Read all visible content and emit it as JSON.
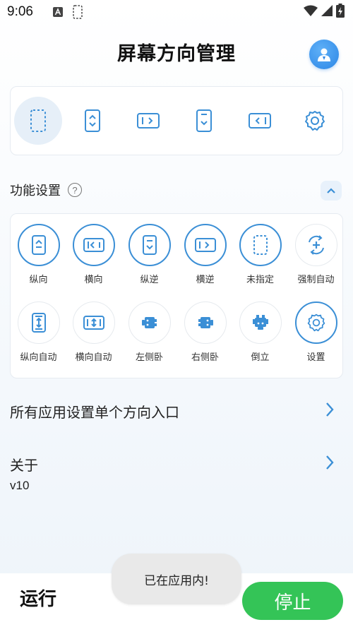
{
  "status_bar": {
    "time": "9:06",
    "icons": [
      "a-badge-icon",
      "dashed-phone-icon",
      "wifi-icon",
      "signal-icon",
      "battery-charging-icon"
    ]
  },
  "header": {
    "title": "屏幕方向管理",
    "avatar_icon": "user-avatar-icon"
  },
  "top_icons": [
    {
      "name": "unspecified",
      "icon": "dashed-phone-icon",
      "active": true
    },
    {
      "name": "portrait",
      "icon": "portrait-phone-icon"
    },
    {
      "name": "landscape",
      "icon": "landscape-phone-icon"
    },
    {
      "name": "reverse-portrait",
      "icon": "reverse-portrait-icon"
    },
    {
      "name": "reverse-landscape",
      "icon": "reverse-landscape-icon"
    },
    {
      "name": "settings",
      "icon": "gear-icon"
    }
  ],
  "function_settings": {
    "title": "功能设置",
    "help": "?",
    "items": [
      {
        "label": "纵向",
        "icon": "portrait-phone-icon"
      },
      {
        "label": "横向",
        "icon": "reverse-landscape-icon"
      },
      {
        "label": "纵逆",
        "icon": "reverse-portrait-icon"
      },
      {
        "label": "横逆",
        "icon": "landscape-phone-icon"
      },
      {
        "label": "未指定",
        "icon": "dashed-phone-icon"
      },
      {
        "label": "强制自动",
        "icon": "rotate-arrows-icon"
      },
      {
        "label": "纵向自动",
        "icon": "portrait-auto-icon"
      },
      {
        "label": "横向自动",
        "icon": "landscape-auto-icon"
      },
      {
        "label": "左侧卧",
        "icon": "robot-left-icon"
      },
      {
        "label": "右侧卧",
        "icon": "robot-right-icon"
      },
      {
        "label": "倒立",
        "icon": "robot-upside-down-icon"
      },
      {
        "label": "设置",
        "icon": "gear-icon"
      }
    ]
  },
  "links": {
    "per_app": "所有应用设置单个方向入口",
    "about": "关于",
    "version": "v10"
  },
  "bottom": {
    "run_label": "运行",
    "stop_label": "停止"
  },
  "toast": "已在应用内!",
  "colors": {
    "accent": "#3b8fd6",
    "stop_green": "#34c457",
    "avatar_blue": "#2b86e6"
  }
}
